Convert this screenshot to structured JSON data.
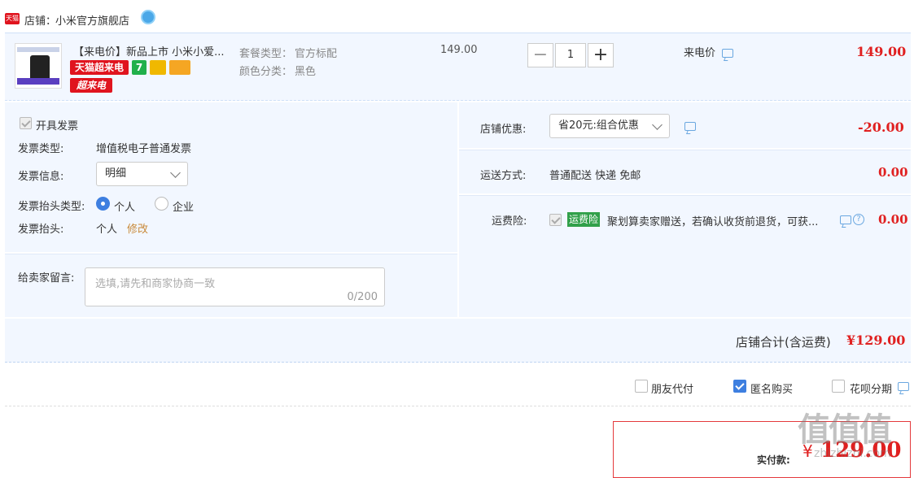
{
  "shop": {
    "platform_badge": "天猫",
    "label": "店铺：",
    "name": "小米官方旗舰店"
  },
  "item": {
    "title": "【来电价】新品上市 小米小爱...",
    "badges": [
      "天猫超来电",
      "7",
      "超来电"
    ],
    "package_label": "套餐类型：",
    "package_value": "官方标配",
    "color_label": "颜色分类：",
    "color_value": "黑色",
    "unit_price": "149.00",
    "quantity": "1",
    "price_tag": "来电价",
    "subtotal": "149.00"
  },
  "invoice": {
    "checkbox_label": "开具发票",
    "type_label": "发票类型:",
    "type_value": "增值税电子普通发票",
    "info_label": "发票信息:",
    "info_selected": "明细",
    "header_type_label": "发票抬头类型:",
    "radio_personal": "个人",
    "radio_company": "企业",
    "header_label": "发票抬头:",
    "header_value": "个人",
    "edit_link": "修改"
  },
  "note": {
    "label": "给卖家留言:",
    "placeholder": "选填,请先和商家协商一致",
    "counter": "0/200"
  },
  "discount": {
    "label": "店铺优惠:",
    "selected": "省20元:组合优惠",
    "amount": "-20.00"
  },
  "shipping": {
    "label": "运送方式:",
    "value": "普通配送 快递 免邮",
    "amount": "0.00"
  },
  "insurance": {
    "label": "运费险:",
    "tag": "运费险",
    "desc": "聚划算卖家赠送，若确认收货前退货，可获...",
    "amount": "0.00"
  },
  "total": {
    "label": "店铺合计(含运费)",
    "amount": "¥129.00"
  },
  "options": {
    "friend_pay": "朋友代付",
    "anonymous": "匿名购买",
    "huabei": "花呗分期"
  },
  "pay": {
    "label": "实付款:",
    "currency": "¥",
    "amount": "129.00"
  },
  "watermark": {
    "logo": "值值值",
    "url": "zhizhizhi.com"
  }
}
